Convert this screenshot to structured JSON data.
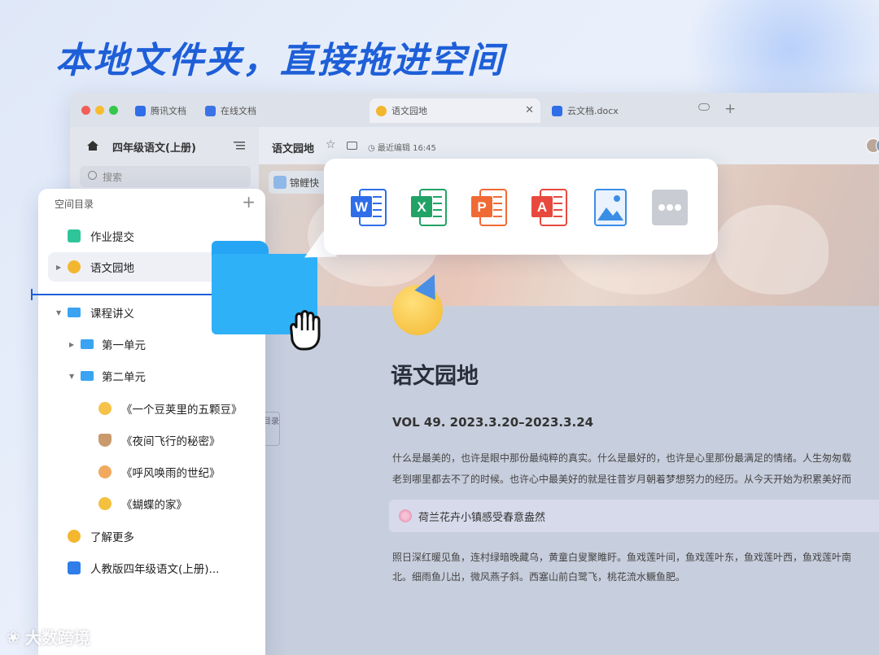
{
  "headline": "本地文件夹，直接拖进空间",
  "tabs": [
    {
      "label": "腾讯文档",
      "icon": "tencent-docs-icon",
      "color": "#2f6ee8"
    },
    {
      "label": "在线文档",
      "icon": "doc-icon",
      "color": "#3b72e6"
    },
    {
      "label": "语文园地",
      "icon": "party-emoji-icon",
      "color": "#f3b72f",
      "active": true
    },
    {
      "label": "云文档.docx",
      "icon": "word-icon",
      "color": "#2f6ee8"
    }
  ],
  "window_sidebar": {
    "space_title": "四年级语文(上册)",
    "search_placeholder": "搜索"
  },
  "main_header": {
    "title": "语文园地",
    "edit_status": "最近编辑 16:45"
  },
  "chip_label": "锦鲤快",
  "toc_label": "目录",
  "document": {
    "title": "语文园地",
    "vol": "VOL 49. 2023.3.20–2023.3.24",
    "para1_line1": "什么是最美的，也许是眼中那份最纯粹的真实。什么是最好的，也许是心里那份最满足的情绪。人生匆匆载",
    "para1_line2": "老到哪里都去不了的时候。也许心中最美好的就是往昔岁月朝着梦想努力的经历。从今天开始为积累美好而",
    "quote": "荷兰花卉小镇感受春意盎然",
    "para2_line1": "照日深红暖见鱼，连村绿暗晚藏乌，黄童白叟聚睢盱。鱼戏莲叶间，鱼戏莲叶东，鱼戏莲叶西，鱼戏莲叶南",
    "para2_line2": "北。细雨鱼儿出，微风燕子斜。西塞山前白鹭飞，桃花流水鳜鱼肥。"
  },
  "panel": {
    "header": "空间目录",
    "items": [
      {
        "label": "作业提交",
        "icon": "homework-icon"
      },
      {
        "label": "语文园地",
        "icon": "party-emoji-icon"
      },
      {
        "label": "课程讲义",
        "icon": "folder-icon"
      },
      {
        "label": "第一单元",
        "icon": "folder-icon"
      },
      {
        "label": "第二单元",
        "icon": "folder-icon"
      },
      {
        "label": "《一个豆荚里的五颗豆》",
        "icon": "sun-emoji-icon"
      },
      {
        "label": "《夜间飞行的秘密》",
        "icon": "coffee-emoji-icon"
      },
      {
        "label": "《呼风唤雨的世纪》",
        "icon": "cat-emoji-icon"
      },
      {
        "label": "《蝴蝶的家》",
        "icon": "sleepy-emoji-icon"
      },
      {
        "label": "了解更多",
        "icon": "party-emoji-icon"
      },
      {
        "label": "人教版四年级语文(上册)...",
        "icon": "link-icon"
      }
    ]
  },
  "file_types": [
    {
      "name": "word-icon",
      "letter": "W",
      "color": "#2f6ee8"
    },
    {
      "name": "excel-icon",
      "letter": "X",
      "color": "#21a366"
    },
    {
      "name": "powerpoint-icon",
      "letter": "P",
      "color": "#f06a35"
    },
    {
      "name": "pdf-icon",
      "letter": "A",
      "color": "#e8493f"
    },
    {
      "name": "image-icon",
      "letter": "",
      "color": "#3a8ee6"
    },
    {
      "name": "more-icon",
      "letter": "",
      "color": "#c9ccd3"
    }
  ],
  "watermark": "大数跨境",
  "colors": {
    "accent": "#1e5fd8",
    "folder": "#2fb1f8"
  }
}
